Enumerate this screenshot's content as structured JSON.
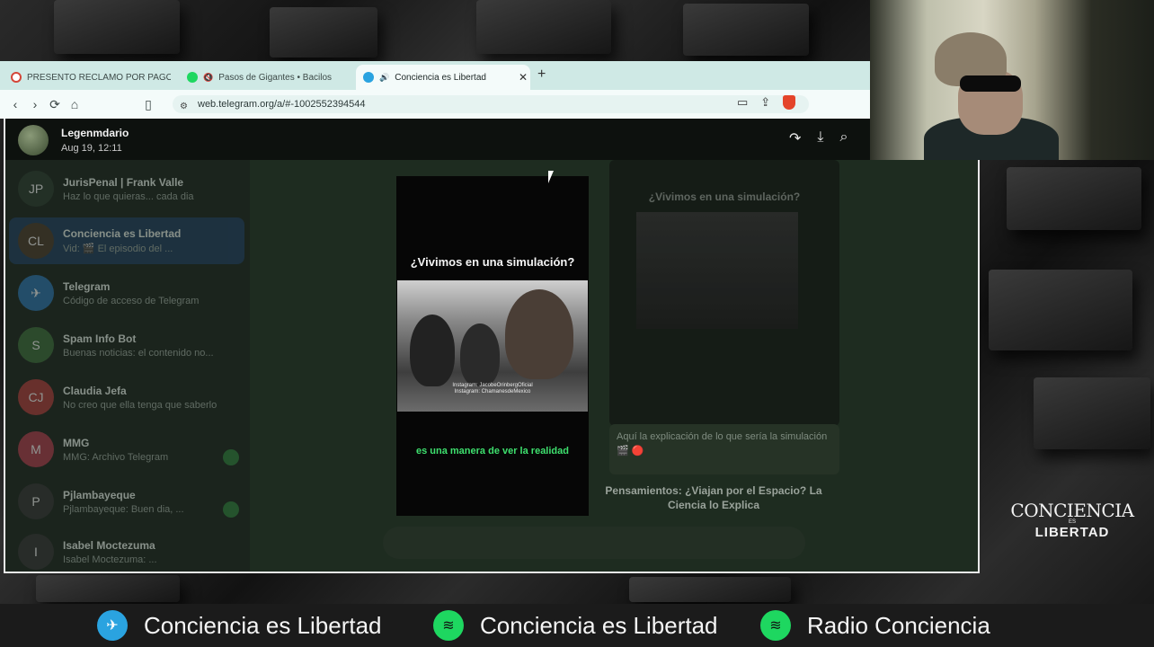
{
  "browser": {
    "tabs": [
      {
        "label": "PRESENTO RECLAMO POR PAGO IN...",
        "icon": "gmail-icon"
      },
      {
        "label": "Pasos de Gigantes • Bacilos",
        "icon": "spotify-icon"
      },
      {
        "label": "Conciencia es Libertad",
        "icon": "telegram-icon",
        "active": true
      }
    ],
    "url": "web.telegram.org/a/#-1002552394544"
  },
  "telegram": {
    "media_viewer": {
      "sender": "Legenmdario",
      "date": "Aug 19, 12:11",
      "video_title": "¿Vivimos en una simulación?",
      "credit_line1": "Instagram: JacobeOrinbergOficial",
      "credit_line2": "Instagram: ChamanesdeMexico",
      "subtitle": "es una manera de ver la realidad"
    },
    "chats": [
      {
        "name": "JurisPenal | Frank Valle",
        "preview": "Haz lo que quieras... cada dia",
        "avatar": "JP",
        "color": "#2b3a2e"
      },
      {
        "name": "Conciencia es Libertad",
        "preview": "Vid: 🎬 El episodio del ...",
        "avatar": "CL",
        "color": "#4a3a2a",
        "selected": true
      },
      {
        "name": "Telegram",
        "preview": "Código de acceso de Telegram",
        "avatar": "✈",
        "color": "#2a6fa8"
      },
      {
        "name": "Spam Info Bot",
        "preview": "Buenas noticias: el contenido no...",
        "avatar": "S",
        "color": "#3a6a3a"
      },
      {
        "name": "Claudia Jefa",
        "preview": "No creo que ella tenga que saberlo",
        "avatar": "CJ",
        "color": "#a83a3a"
      },
      {
        "name": "MMG",
        "preview": "MMG: Archivo Telegram",
        "avatar": "M",
        "color": "#a83a4a"
      },
      {
        "name": "Pjlambayeque",
        "preview": "Pjlambayeque: Buen dia, ...",
        "avatar": "P",
        "color": "#333"
      },
      {
        "name": "Isabel Moctezuma",
        "preview": "Isabel Moctezuma: ...",
        "avatar": "I",
        "color": "#333"
      }
    ],
    "bg_message": {
      "title": "¿Vivimos en una simulación?",
      "caption": "Aquí la explicación de lo que sería la simulación 🎬 🔴",
      "post_title": "Pensamientos: ¿Viajan por el Espacio? La Ciencia lo Explica"
    }
  },
  "logo": {
    "line1": "CONCIENCIA",
    "line2": "ES",
    "line3": "LIBERTAD"
  },
  "banner": [
    {
      "label": "Conciencia es Libertad",
      "icon": "telegram-icon",
      "color": "#2aa3e0"
    },
    {
      "label": "Conciencia es Libertad",
      "icon": "spotify-icon",
      "color": "#1ed760"
    },
    {
      "label": "Radio Conciencia",
      "icon": "spotify-icon",
      "color": "#1ed760"
    }
  ]
}
